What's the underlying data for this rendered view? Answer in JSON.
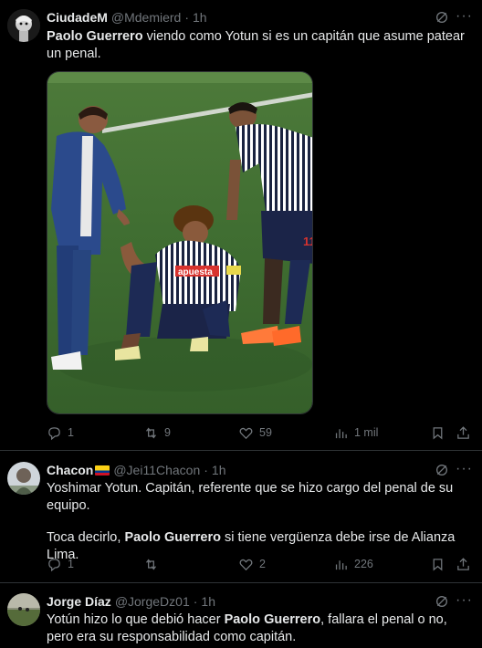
{
  "tweets": [
    {
      "name": "CiudadeM",
      "handle": "@Mdemierd",
      "time": "1h",
      "text_bold": "Paolo Guerrero",
      "text_rest": " viendo como Yotun si es un capitán que asume patear un penal.",
      "replies": "1",
      "retweets": "9",
      "likes": "59",
      "views": "1 mil"
    },
    {
      "name": "Chacon",
      "flag": "🇨🇴",
      "handle": "@Jei11Chacon",
      "time": "1h",
      "line1": "Yoshimar Yotun. Capitán, referente que se hizo cargo del penal de su equipo.",
      "line2_pre": "Toca decirlo, ",
      "line2_bold": "Paolo Guerrero",
      "line2_post": " si tiene vergüenza debe irse de Alianza Lima.",
      "replies": "1",
      "retweets": "",
      "likes": "2",
      "views": "226"
    },
    {
      "name": "Jorge Díaz",
      "handle": "@JorgeDz01",
      "time": "1h",
      "text_pre": "Yotún hizo lo que debió hacer ",
      "text_bold": "Paolo Guerrero",
      "text_post": ", fallara el penal o no, pero era su responsabilidad como capitán."
    }
  ],
  "photo": {
    "shirt_sponsor": "apuesta",
    "jersey_number": "11"
  },
  "icons": {
    "reply": "reply-icon",
    "retweet": "retweet-icon",
    "like": "heart-icon",
    "views": "views-icon",
    "bookmark": "bookmark-icon",
    "share": "share-icon",
    "grok": "grok-icon",
    "more": "more-icon"
  },
  "colors": {
    "background": "#000000",
    "text": "#e7e9ea",
    "muted": "#71767b",
    "divider": "#2f3336"
  }
}
